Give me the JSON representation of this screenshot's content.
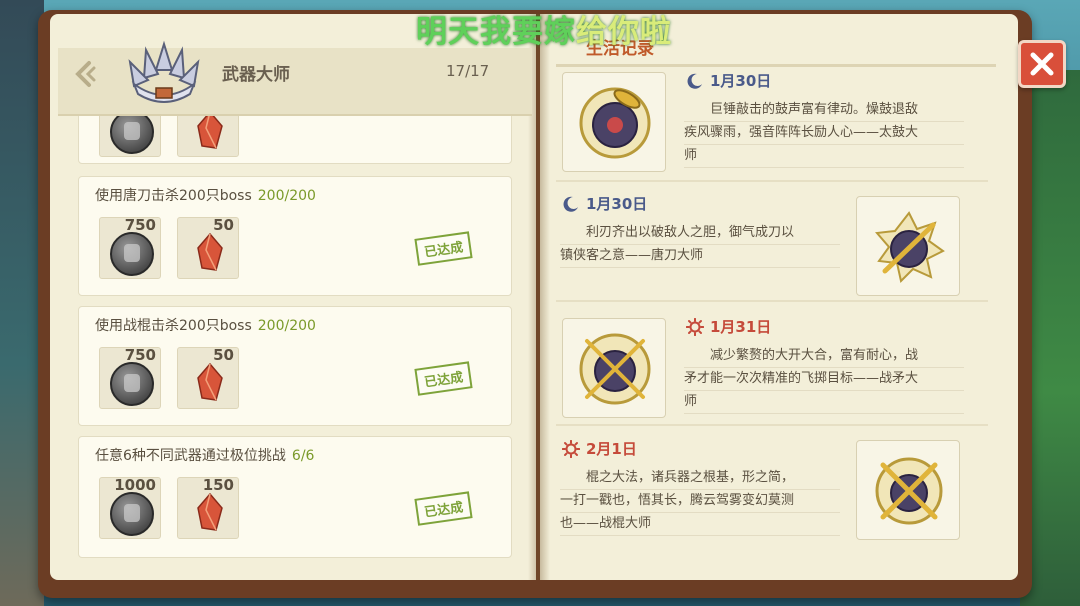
{
  "overlay_text": {
    "head": "明天我要嫁",
    "tail": "给你啦"
  },
  "left_page": {
    "back_icon": "chevron-left-icon",
    "title": "武器大师",
    "count": "17/17",
    "cards": [
      {
        "title": "使用唐刀击杀200只boss",
        "progress": "200/200",
        "rewards": [
          {
            "type": "coin",
            "amount": "750"
          },
          {
            "type": "gem",
            "amount": "50"
          }
        ],
        "status": "已达成"
      },
      {
        "title": "使用战棍击杀200只boss",
        "progress": "200/200",
        "rewards": [
          {
            "type": "coin",
            "amount": "750"
          },
          {
            "type": "gem",
            "amount": "50"
          }
        ],
        "status": "已达成"
      },
      {
        "title": "任意6种不同武器通过极位挑战",
        "progress": "6/6",
        "rewards": [
          {
            "type": "coin",
            "amount": "1000"
          },
          {
            "type": "gem",
            "amount": "150"
          }
        ],
        "status": "已达成"
      }
    ]
  },
  "right_page": {
    "title": "生活记录",
    "entries": [
      {
        "icon": "moon-icon",
        "date": "1月30日",
        "lines": [
          "巨锤敲击的鼓声富有律动。燥鼓退敌",
          "疾风骤雨，强音阵阵长励人心——太鼓大",
          "师"
        ]
      },
      {
        "icon": "moon-icon",
        "date": "1月30日",
        "lines": [
          "利刃齐出以破敌人之胆，御气成刀以",
          "镇侠客之意——唐刀大师"
        ]
      },
      {
        "icon": "sun-icon",
        "date": "1月31日",
        "lines": [
          "减少繁赘的大开大合，富有耐心，战",
          "矛才能一次次精准的飞掷目标——战矛大",
          "师"
        ]
      },
      {
        "icon": "sun-icon",
        "date": "2月1日",
        "lines": [
          "棍之大法，诸兵器之根基，形之简，",
          "一打一戳也，悟其长，腾云驾雾变幻莫测",
          "也——战棍大师"
        ]
      }
    ]
  },
  "colors": {
    "accent_green": "#7ea33a",
    "title_red": "#c05a2a",
    "moon_blue": "#4a5a8a",
    "sun_red": "#c54a3a",
    "close_red": "#d94f3a"
  }
}
